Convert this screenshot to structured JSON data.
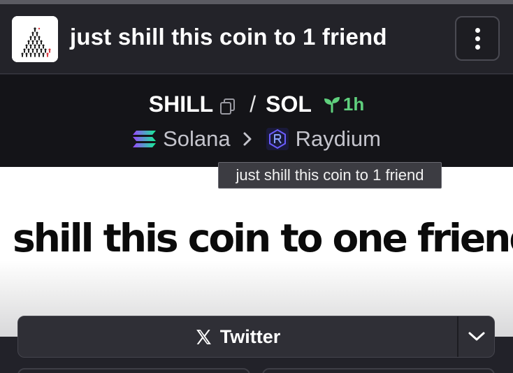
{
  "header": {
    "title": "just shill this coin to 1 friend",
    "logo_icon": "shill-pyramid-logo-icon",
    "menu_icon": "more-vertical-icon"
  },
  "pair": {
    "base_symbol": "SHILL",
    "separator": "/",
    "quote_symbol": "SOL",
    "age": "1h",
    "age_icon": "seedling-icon",
    "copy_icon": "copy-icon"
  },
  "chain": {
    "name": "Solana",
    "icon": "solana-icon",
    "dex": "Raydium",
    "dex_icon": "raydium-icon"
  },
  "tooltip": {
    "text": "just shill this coin to 1 friend"
  },
  "banner": {
    "text": "shill this coin to one friend"
  },
  "social": {
    "twitter_label": "Twitter",
    "twitter_icon": "x-logo-icon",
    "dropdown_icon": "chevron-down-icon"
  },
  "colors": {
    "accent_green": "#5fd07d",
    "background": "#222229",
    "pair_bar": "#141418"
  }
}
